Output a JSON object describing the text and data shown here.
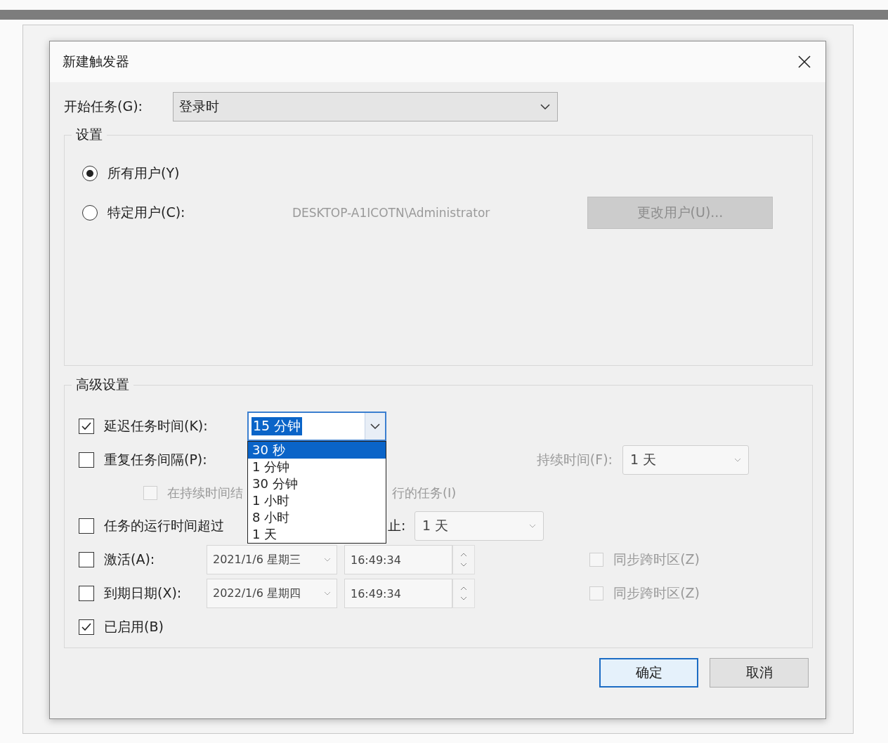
{
  "window": {
    "title": "新建触发器"
  },
  "begin_task": {
    "label": "开始任务(G):",
    "value": "登录时"
  },
  "settings": {
    "title": "设置",
    "options": [
      {
        "label": "所有用户(Y)",
        "selected": true
      },
      {
        "label": "特定用户(C):",
        "selected": false
      }
    ],
    "user": "DESKTOP-A1ICOTN\\Administrator",
    "change_user_button": {
      "label": "更改用户(U)...",
      "disabled": true
    }
  },
  "advanced": {
    "title": "高级设置",
    "delay": {
      "label": "延迟任务时间(K):",
      "checked": true,
      "value": "15 分钟",
      "expanded": true,
      "options": [
        {
          "label": "30 秒",
          "selected": true
        },
        {
          "label": "1 分钟",
          "selected": false
        },
        {
          "label": "30 分钟",
          "selected": false
        },
        {
          "label": "1 小时",
          "selected": false
        },
        {
          "label": "8 小时",
          "selected": false
        },
        {
          "label": "1 天",
          "selected": false
        }
      ]
    },
    "repeat": {
      "label": "重复任务间隔(P):",
      "checked": false,
      "duration_label": "持续时间(F):",
      "duration_value": "1 天"
    },
    "stop_all": {
      "label_parts": [
        "在持续时间结",
        "行的任务(I)"
      ],
      "checked": false,
      "disabled": true
    },
    "stop_long": {
      "label_parts": [
        "任务的运行时间超过",
        "止:"
      ],
      "checked": false,
      "value": "1 天"
    },
    "activate": {
      "label": "激活(A):",
      "checked": false,
      "date": "2021/1/6 星期三",
      "time": "16:49:34",
      "sync_label": "同步跨时区(Z)",
      "sync_checked": false
    },
    "expire": {
      "label": "到期日期(X):",
      "checked": false,
      "date": "2022/1/6 星期四",
      "time": "16:49:34",
      "sync_label": "同步跨时区(Z)",
      "sync_checked": false
    },
    "enabled": {
      "label": "已启用(B)",
      "checked": true
    }
  },
  "buttons": [
    {
      "label": "确定",
      "default": true
    },
    {
      "label": "取消",
      "default": false
    }
  ]
}
